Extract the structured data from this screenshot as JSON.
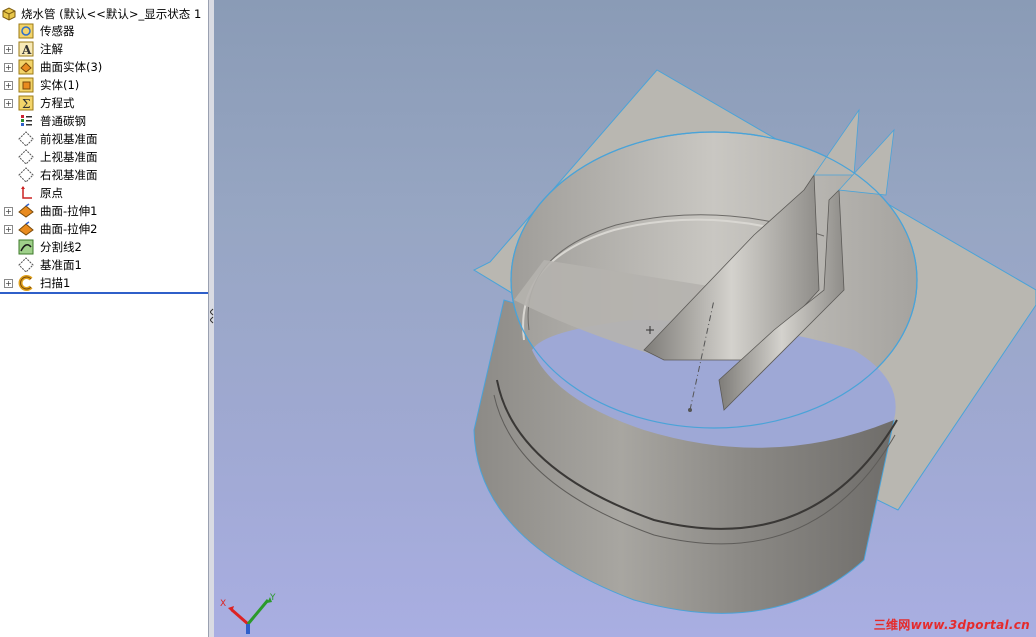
{
  "tree": {
    "root_label": "烧水管  (默认<<默认>_显示状态 1",
    "items": [
      {
        "label": "传感器",
        "expandable": false
      },
      {
        "label": "注解",
        "expandable": true
      },
      {
        "label": "曲面实体(3)",
        "expandable": true
      },
      {
        "label": "实体(1)",
        "expandable": true
      },
      {
        "label": "方程式",
        "expandable": true
      },
      {
        "label": "普通碳钢",
        "expandable": false
      },
      {
        "label": "前视基准面",
        "expandable": false
      },
      {
        "label": "上视基准面",
        "expandable": false
      },
      {
        "label": "右视基准面",
        "expandable": false
      },
      {
        "label": "原点",
        "expandable": false
      },
      {
        "label": "曲面-拉伸1",
        "expandable": true
      },
      {
        "label": "曲面-拉伸2",
        "expandable": true
      },
      {
        "label": "分割线2",
        "expandable": false
      },
      {
        "label": "基准面1",
        "expandable": false
      },
      {
        "label": "扫描1",
        "expandable": true
      }
    ],
    "expand_glyph": "+"
  },
  "triad": {
    "x_label": "X",
    "y_label": "Y",
    "z_label": "Z"
  },
  "watermark": {
    "cn": "三维网",
    "url": "www.3dportal.cn"
  },
  "colors": {
    "viewport_top": "#8a9bb6",
    "viewport_bottom": "#a9aee2",
    "edge_highlight": "#4aa3d8",
    "surface": "#b9b7b1"
  }
}
